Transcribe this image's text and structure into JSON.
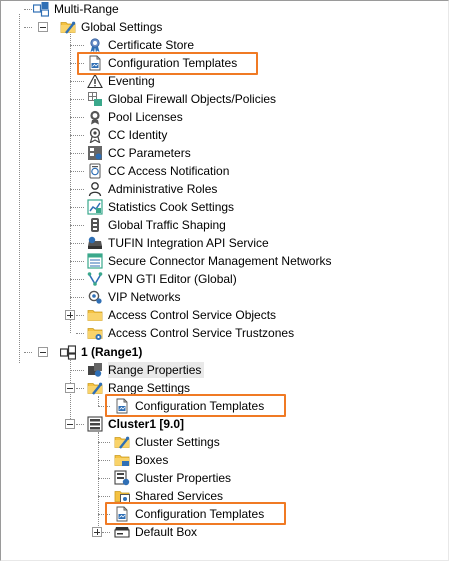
{
  "tree": {
    "root": {
      "label": "Multi-Range",
      "icon": "network-range-icon"
    },
    "global_settings": {
      "label": "Global Settings",
      "icon": "folder-settings-icon",
      "items": [
        {
          "label": "Certificate Store",
          "icon": "certificate-icon"
        },
        {
          "label": "Configuration Templates",
          "icon": "document-template-icon",
          "highlighted": true
        },
        {
          "label": "Eventing",
          "icon": "warning-icon"
        },
        {
          "label": "Global Firewall Objects/Policies",
          "icon": "firewall-objects-icon"
        },
        {
          "label": "Pool Licenses",
          "icon": "license-icon"
        },
        {
          "label": "CC Identity",
          "icon": "identity-icon"
        },
        {
          "label": "CC Parameters",
          "icon": "parameters-icon"
        },
        {
          "label": "CC Access Notification",
          "icon": "notification-icon"
        },
        {
          "label": "Administrative Roles",
          "icon": "user-role-icon"
        },
        {
          "label": "Statistics Cook Settings",
          "icon": "statistics-icon"
        },
        {
          "label": "Global Traffic Shaping",
          "icon": "traffic-shaping-icon"
        },
        {
          "label": "TUFIN Integration API Service",
          "icon": "api-service-icon"
        },
        {
          "label": "Secure Connector Management Networks",
          "icon": "network-grid-icon"
        },
        {
          "label": "VPN GTI Editor (Global)",
          "icon": "vpn-gti-icon"
        },
        {
          "label": "VIP Networks",
          "icon": "vip-network-icon"
        },
        {
          "label": "Access Control Service Objects",
          "icon": "folder-icon"
        },
        {
          "label": "Access Control Service Trustzones",
          "icon": "folder-trustzone-icon"
        }
      ]
    },
    "range": {
      "label": "1 (Range1)",
      "icon": "range-icon",
      "properties": {
        "label": "Range Properties",
        "icon": "range-properties-icon"
      },
      "settings": {
        "label": "Range Settings",
        "icon": "folder-settings-icon"
      },
      "settings_templates": {
        "label": "Configuration Templates",
        "icon": "document-template-icon",
        "highlighted": true
      },
      "cluster": {
        "label": "Cluster1 [9.0]",
        "icon": "cluster-icon",
        "items": [
          {
            "label": "Cluster Settings",
            "icon": "folder-settings-icon"
          },
          {
            "label": "Boxes",
            "icon": "folder-boxes-icon"
          },
          {
            "label": "Cluster Properties",
            "icon": "cluster-properties-icon"
          },
          {
            "label": "Shared Services",
            "icon": "shared-services-icon"
          },
          {
            "label": "Configuration Templates",
            "icon": "document-template-icon",
            "highlighted": true
          },
          {
            "label": "Default Box",
            "icon": "box-icon"
          }
        ]
      }
    }
  },
  "colors": {
    "highlight_border": "#f07a24",
    "folder_yellow": "#f5c242",
    "icon_blue": "#2f6fb5",
    "selection_bg": "#e9e9e9"
  }
}
